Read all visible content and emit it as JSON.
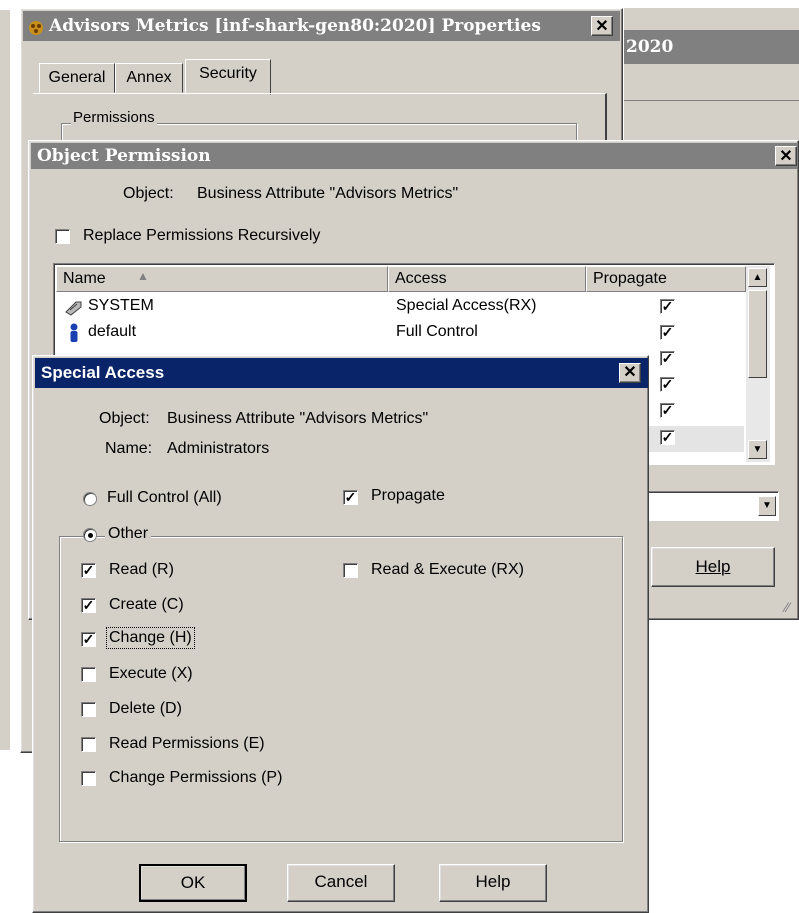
{
  "properties_window": {
    "title": "Advisors Metrics [inf-shark-gen80:2020] Properties",
    "tabs": [
      {
        "label": "General"
      },
      {
        "label": "Annex"
      },
      {
        "label": "Security",
        "selected": true
      }
    ],
    "permissions_group_label": "Permissions"
  },
  "background_window": {
    "title_fragment": "2020",
    "help_label": "Help"
  },
  "object_permission": {
    "title": "Object Permission",
    "object_label": "Object:",
    "object_value": "Business Attribute \"Advisors Metrics\"",
    "replace_recursive_label": "Replace Permissions Recursively",
    "replace_recursive_checked": false,
    "columns": [
      "Name",
      "Access",
      "Propagate"
    ],
    "rows": [
      {
        "name": "SYSTEM",
        "icon": "system-key-icon",
        "access": "Special Access(RX)",
        "propagate": true
      },
      {
        "name": "default",
        "icon": "user-icon",
        "access": "Full Control",
        "propagate": true
      },
      {
        "name": "",
        "icon": "",
        "access": "",
        "propagate": true
      },
      {
        "name": "",
        "icon": "",
        "access": "",
        "propagate": true
      },
      {
        "name": "",
        "icon": "",
        "access": "",
        "propagate": true
      },
      {
        "name": "",
        "icon": "",
        "access": "",
        "propagate": true
      }
    ]
  },
  "special_access": {
    "title": "Special Access",
    "object_label": "Object:",
    "object_value": "Business Attribute \"Advisors Metrics\"",
    "name_label": "Name:",
    "name_value": "Administrators",
    "full_control_label": "Full Control (All)",
    "other_label": "Other",
    "selected_option": "Other",
    "propagate_label": "Propagate",
    "propagate_checked": true,
    "permissions": [
      {
        "label": "Read (R)",
        "checked": true
      },
      {
        "label": "Create (C)",
        "checked": true
      },
      {
        "label": "Change (H)",
        "checked": true
      },
      {
        "label": "Execute (X)",
        "checked": false
      },
      {
        "label": "Delete (D)",
        "checked": false
      },
      {
        "label": "Read Permissions (E)",
        "checked": false
      },
      {
        "label": "Change Permissions (P)",
        "checked": false
      }
    ],
    "read_execute": {
      "label": "Read & Execute (RX)",
      "checked": false
    },
    "buttons": {
      "ok": "OK",
      "cancel": "Cancel",
      "help": "Help"
    }
  },
  "colors": {
    "dialog_face": "#d4d0c8",
    "inactive_title": "#808080",
    "active_title": "#0a246a"
  }
}
